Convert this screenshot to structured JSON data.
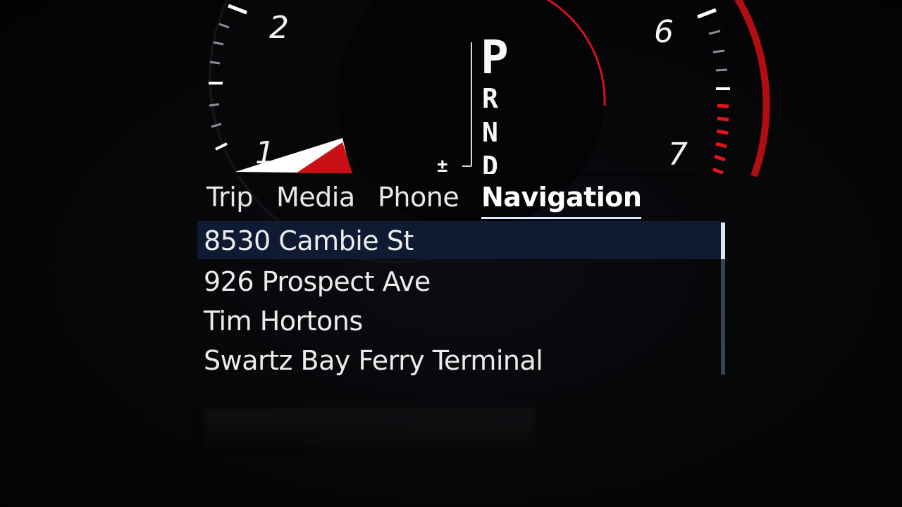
{
  "gauge": {
    "speed_labels": [
      "1",
      "2",
      "6",
      "7"
    ]
  },
  "gear": {
    "current": "P",
    "options": [
      "R",
      "N",
      "D"
    ],
    "manual_symbol": "±"
  },
  "tabs": [
    {
      "label": "Trip",
      "active": false
    },
    {
      "label": "Media",
      "active": false
    },
    {
      "label": "Phone",
      "active": false
    },
    {
      "label": "Navigation",
      "active": true
    }
  ],
  "navigation": {
    "destinations": [
      {
        "label": "8530 Cambie St",
        "selected": true
      },
      {
        "label": "926 Prospect Ave",
        "selected": false
      },
      {
        "label": "Tim Hortons",
        "selected": false
      },
      {
        "label": "Swartz Bay Ferry Terminal",
        "selected": false
      }
    ]
  },
  "colors": {
    "accent_red": "#e0141c",
    "selection": "#0f1b33",
    "text": "#f2f2f2",
    "tab_underline": "#d9ecff"
  }
}
